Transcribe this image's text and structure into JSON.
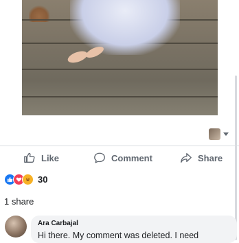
{
  "post": {
    "photo": {
      "alt_semantic": "post-photo"
    },
    "actor_avatar_icon": "avatar-icon"
  },
  "actions": {
    "like_label": "Like",
    "comment_label": "Comment",
    "share_label": "Share"
  },
  "reactions": {
    "types": [
      "like",
      "love",
      "haha"
    ],
    "count": "30"
  },
  "shares": {
    "text": "1 share"
  },
  "comment": {
    "author": "Ara Carbajal",
    "text": "Hi there. My comment was deleted. I need"
  },
  "colors": {
    "action_text": "#606770",
    "like_blue": "#1877f2",
    "love_red": "#f33e58",
    "haha_yellow": "#f7b125",
    "bubble_bg": "#f2f3f5"
  }
}
